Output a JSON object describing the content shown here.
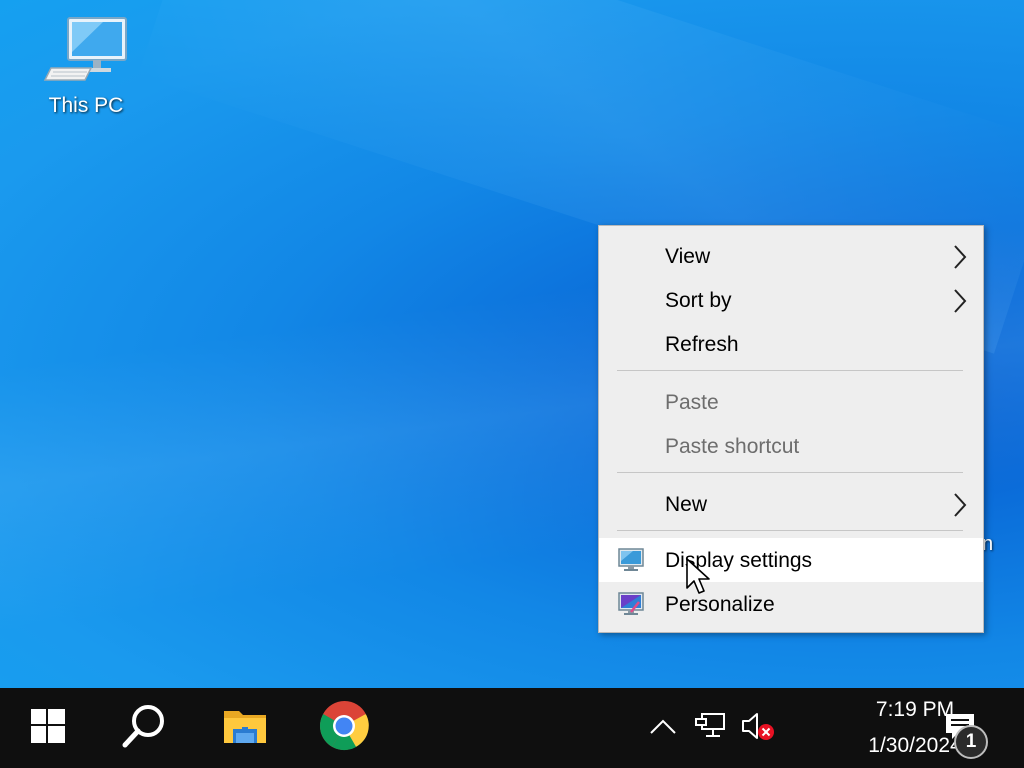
{
  "desktop": {
    "icons": [
      {
        "label": "This PC",
        "icon": "monitor-computer-icon"
      }
    ],
    "stray_text": "n"
  },
  "context_menu": {
    "items": [
      {
        "label": "View",
        "enabled": true,
        "submenu": true
      },
      {
        "label": "Sort by",
        "enabled": true,
        "submenu": true
      },
      {
        "label": "Refresh",
        "enabled": true,
        "submenu": false
      },
      {
        "label": "Paste",
        "enabled": false,
        "submenu": false
      },
      {
        "label": "Paste shortcut",
        "enabled": false,
        "submenu": false
      },
      {
        "label": "New",
        "enabled": true,
        "submenu": true
      },
      {
        "label": "Display settings",
        "enabled": true,
        "submenu": false,
        "icon": "display-settings-icon",
        "highlighted": true
      },
      {
        "label": "Personalize",
        "enabled": true,
        "submenu": false,
        "icon": "personalize-icon"
      }
    ]
  },
  "taskbar": {
    "pinned": [
      {
        "name": "start-button",
        "icon": "windows-logo-icon"
      },
      {
        "name": "search-button",
        "icon": "search-icon"
      },
      {
        "name": "file-explorer",
        "icon": "folder-icon"
      },
      {
        "name": "chrome",
        "icon": "chrome-icon"
      }
    ],
    "tray": {
      "icons": [
        "chevron-up-icon",
        "network-icon",
        "volume-muted-icon"
      ],
      "time": "7:19 PM",
      "date": "1/30/2024",
      "notification_count": "1"
    }
  },
  "colors": {
    "taskbar_bg": "#0f0f0f",
    "menu_bg": "#eeeeee",
    "menu_hover_bg": "#ffffff",
    "disabled_text": "#6d6d6d"
  }
}
